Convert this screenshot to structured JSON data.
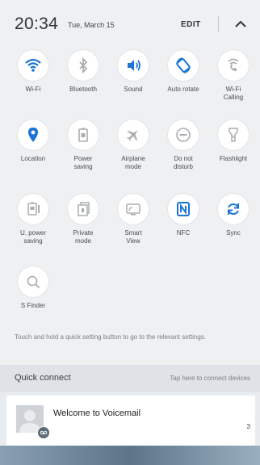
{
  "header": {
    "time": "20:34",
    "date": "Tue, March 15",
    "edit_label": "EDIT",
    "collapse_icon": "chevron-up-icon"
  },
  "tiles": [
    {
      "label": "Wi-Fi",
      "icon": "wifi-icon",
      "active": true
    },
    {
      "label": "Bluetooth",
      "icon": "bluetooth-icon",
      "active": false
    },
    {
      "label": "Sound",
      "icon": "sound-icon",
      "active": true
    },
    {
      "label": "Auto rotate",
      "icon": "auto-rotate-icon",
      "active": true
    },
    {
      "label": "Wi-Fi Calling",
      "icon": "wifi-calling-icon",
      "active": false
    },
    {
      "label": "Location",
      "icon": "location-icon",
      "active": true
    },
    {
      "label": "Power saving",
      "icon": "power-saving-icon",
      "active": false
    },
    {
      "label": "Airplane mode",
      "icon": "airplane-icon",
      "active": false
    },
    {
      "label": "Do not disturb",
      "icon": "do-not-disturb-icon",
      "active": false
    },
    {
      "label": "Flashlight",
      "icon": "flashlight-icon",
      "active": false
    },
    {
      "label": "U. power saving",
      "icon": "ultra-power-saving-icon",
      "active": false
    },
    {
      "label": "Private mode",
      "icon": "private-mode-icon",
      "active": false
    },
    {
      "label": "Smart View",
      "icon": "smart-view-icon",
      "active": false
    },
    {
      "label": "NFC",
      "icon": "nfc-icon",
      "active": true
    },
    {
      "label": "Sync",
      "icon": "sync-icon",
      "active": true
    },
    {
      "label": "S Finder",
      "icon": "search-icon",
      "active": false
    }
  ],
  "hint": "Touch and hold a quick setting button to go to the relevant settings.",
  "quick_connect": {
    "title": "Quick connect",
    "hint": "Tap here to connect devices"
  },
  "notification": {
    "title": "Welcome to Voicemail",
    "count": "3"
  },
  "colors": {
    "active": "#1a73d6",
    "inactive": "#a9adb1",
    "panel_bg": "#eef0f2"
  }
}
